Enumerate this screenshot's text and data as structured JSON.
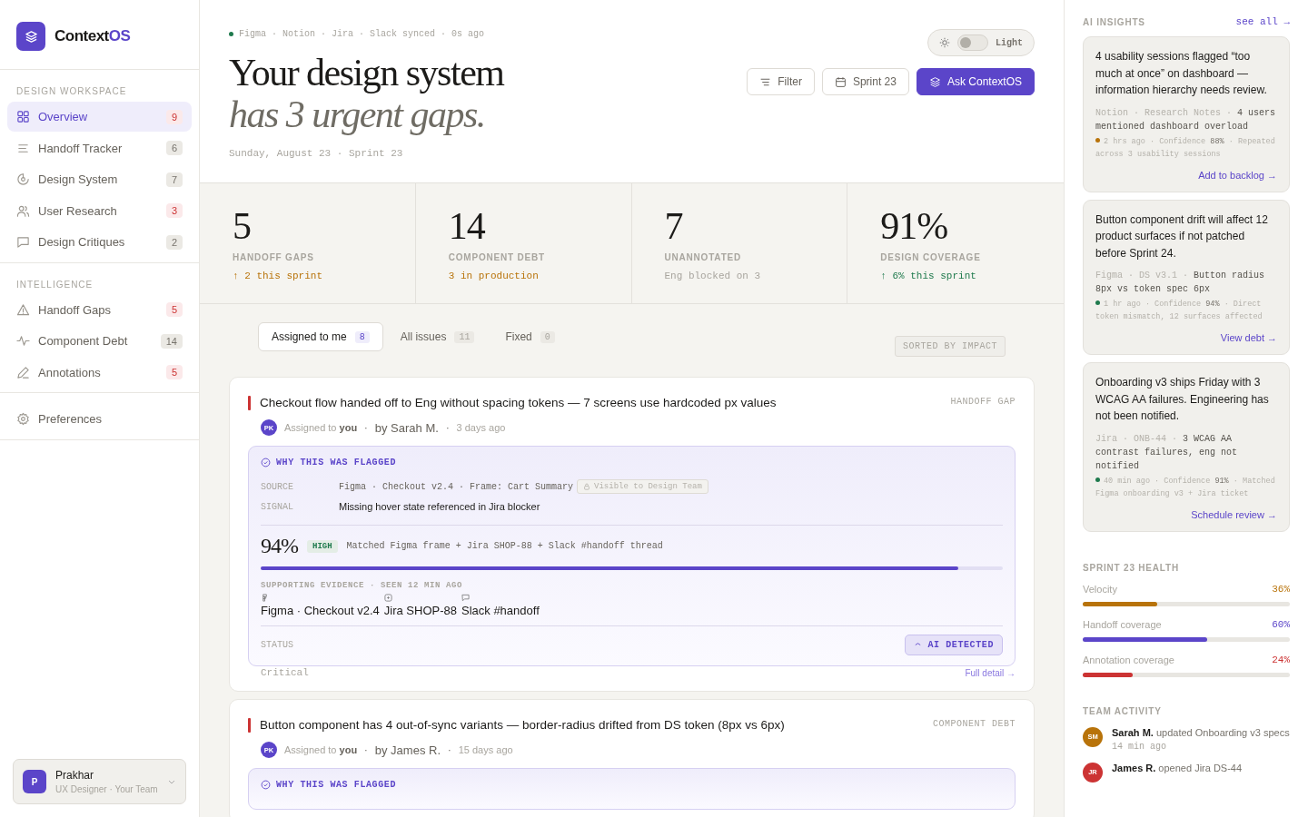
{
  "brand": {
    "name": "Context",
    "accent": "OS"
  },
  "sidebar": {
    "sections": [
      {
        "title": "DESIGN WORKSPACE",
        "items": [
          {
            "label": "Overview",
            "count": "9",
            "urgent": true,
            "selected": true
          },
          {
            "label": "Handoff Tracker",
            "count": "6",
            "urgent": false,
            "selected": false
          },
          {
            "label": "Design System",
            "count": "7",
            "urgent": false,
            "selected": false
          },
          {
            "label": "User Research",
            "count": "3",
            "urgent": true,
            "selected": false
          },
          {
            "label": "Design Critiques",
            "count": "2",
            "urgent": false,
            "selected": false
          }
        ]
      },
      {
        "title": "INTELLIGENCE",
        "items": [
          {
            "label": "Handoff Gaps",
            "count": "5",
            "urgent": true,
            "selected": false
          },
          {
            "label": "Component Debt",
            "count": "14",
            "urgent": false,
            "selected": false
          },
          {
            "label": "Annotations",
            "count": "5",
            "urgent": true,
            "selected": false
          }
        ]
      }
    ],
    "preferences": {
      "label": "Preferences"
    },
    "user": {
      "initial": "P",
      "name": "Prakhar",
      "role": "UX Designer · Your Team"
    }
  },
  "header": {
    "sync_status": "Figma · Notion · Jira · Slack synced · 0s ago",
    "title": "Your design system",
    "subtitle": "has 3 urgent gaps.",
    "date_line": "Sunday, August 23 · Sprint 23",
    "theme": {
      "label": "Light",
      "on": false
    },
    "buttons": [
      {
        "kind": "filter",
        "label": "Filter"
      },
      {
        "kind": "calendar",
        "label": "Sprint 23"
      },
      {
        "kind": "primary",
        "label": "Ask ContextOS"
      }
    ]
  },
  "stats": [
    {
      "value": "5",
      "label": "HANDOFF GAPS",
      "note": "↑ 2 this sprint",
      "color": "#b8730a"
    },
    {
      "value": "14",
      "label": "COMPONENT DEBT",
      "note": "3 in production",
      "color": "#b8730a"
    },
    {
      "value": "7",
      "label": "UNANNOTATED",
      "note": "Eng blocked on 3",
      "color": "#a8a59e"
    },
    {
      "value": "91%",
      "label": "DESIGN COVERAGE",
      "note": "↑ 6% this sprint",
      "color": "#1f7a4d"
    }
  ],
  "tabs": [
    {
      "label": "Assigned to me",
      "count": "8",
      "selected": true
    },
    {
      "label": "All issues",
      "count": "11",
      "selected": false
    },
    {
      "label": "Fixed",
      "count": "0",
      "selected": false
    }
  ],
  "sort_label": "SORTED BY IMPACT",
  "issues": [
    {
      "title": "Checkout flow handed off to Eng without spacing tokens — 7 screens use hardcoded px values",
      "category": "HANDOFF GAP",
      "initials": "PK",
      "meta": [
        {
          "kind": "assigned",
          "text": "Assigned to **you**"
        },
        {
          "kind": "separator",
          "text": "·"
        },
        {
          "kind": "author",
          "text": "by Sarah M."
        },
        {
          "kind": "separator",
          "text": "·"
        },
        {
          "kind": "age",
          "text": "3 days ago"
        }
      ],
      "flag": {
        "heading": "WHY THIS WAS FLAGGED",
        "source_label": "SOURCE",
        "source": "Figma · Checkout v2.4 · Frame: Cart Summary",
        "source_tag": "Visible to Design Team",
        "signal_label": "SIGNAL",
        "signal": "Missing hover state referenced in Jira blocker",
        "confidence": "94%",
        "confidence_tag": "HIGH",
        "match": "Matched Figma frame + Jira SHOP-88 + Slack #handoff thread",
        "level": 0.94,
        "evidence_label": "SUPPORTING EVIDENCE · SEEN 12 MIN AGO",
        "evidence": [
          {
            "kind": "figma",
            "label": "Figma · Checkout v2.4"
          },
          {
            "kind": "jira",
            "label": "Jira SHOP-88"
          },
          {
            "kind": "slack",
            "label": "Slack #handoff"
          }
        ],
        "status_label": "STATUS",
        "status_badge": "AI DETECTED"
      },
      "severity": "Critical",
      "link": "Full detail →"
    },
    {
      "title": "Button component has 4 out-of-sync variants — border-radius drifted from DS token (8px vs 6px)",
      "category": "COMPONENT DEBT",
      "initials": "PK",
      "meta": [
        {
          "kind": "assigned",
          "text": "Assigned to **you**"
        },
        {
          "kind": "separator",
          "text": "·"
        },
        {
          "kind": "author",
          "text": "by James R."
        },
        {
          "kind": "separator",
          "text": "·"
        },
        {
          "kind": "age",
          "text": "15 days ago"
        }
      ],
      "flag": {
        "heading": "WHY THIS WAS FLAGGED"
      }
    }
  ],
  "insights": {
    "title": "AI INSIGHTS",
    "link": "see all →",
    "cards": [
      {
        "text": "4 usability sessions flagged “too much at once” on dashboard — information hierarchy needs review.",
        "source": "Notion · Research Notes · **4 users mentioned dashboard overload**",
        "color": "#b8730a",
        "meta": "2 hrs ago · Confidence **88%** · Repeated across 3 usability sessions",
        "action": "Add to backlog →"
      },
      {
        "text": "Button component drift will affect 12 product surfaces if not patched before Sprint 24.",
        "source": "Figma · DS v3.1 · **Button radius 8px vs token spec 6px**",
        "color": "#1f7a4d",
        "meta": "1 hr ago · Confidence **94%** · Direct token mismatch, 12 surfaces affected",
        "action": "View debt →"
      },
      {
        "text": "Onboarding v3 ships Friday with 3 WCAG AA failures. Engineering has not been notified.",
        "source": "Jira · ONB-44 · **3 WCAG AA contrast failures, eng not notified**",
        "color": "#1f7a4d",
        "meta": "40 min ago · Confidence **91%** · Matched Figma onboarding v3 + Jira ticket",
        "action": "Schedule review →"
      }
    ]
  },
  "health": {
    "title": "SPRINT 23 HEALTH",
    "metrics": [
      {
        "label": "Velocity",
        "value": "36%",
        "level": 0.36,
        "color": "#b8730a"
      },
      {
        "label": "Handoff coverage",
        "value": "60%",
        "level": 0.6,
        "color": "#5b45c9"
      },
      {
        "label": "Annotation coverage",
        "value": "24%",
        "level": 0.24,
        "color": "#cc3333"
      }
    ]
  },
  "activity": {
    "title": "TEAM ACTIVITY",
    "items": [
      {
        "initials": "SM",
        "color": "#b8730a",
        "name": "Sarah M.",
        "action": "updated Onboarding v3 specs",
        "time": "14 min ago"
      },
      {
        "initials": "JR",
        "color": "#cc3333",
        "name": "James R.",
        "action": "opened Jira DS-44"
      }
    ]
  }
}
